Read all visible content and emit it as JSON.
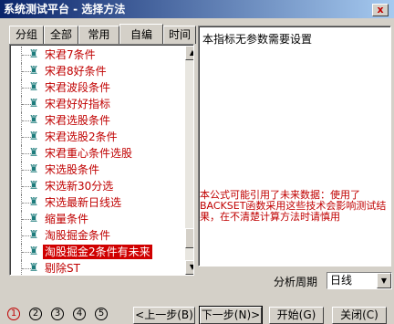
{
  "window": {
    "title": "系统测试平台 - 选择方法",
    "close_label": "x"
  },
  "tabs": [
    {
      "label": "分组"
    },
    {
      "label": "全部"
    },
    {
      "label": "常用"
    },
    {
      "label": "自编"
    },
    {
      "label": "时间"
    }
  ],
  "active_tab": "自编",
  "list": {
    "items": [
      {
        "label": "宋君7条件"
      },
      {
        "label": "宋君8好条件"
      },
      {
        "label": "宋君波段条件"
      },
      {
        "label": "宋君好好指标"
      },
      {
        "label": "宋君选股条件"
      },
      {
        "label": "宋君选股2条件"
      },
      {
        "label": "宋君重心条件选股"
      },
      {
        "label": "宋选股条件"
      },
      {
        "label": "宋选新30分选"
      },
      {
        "label": "宋选最新日线选"
      },
      {
        "label": "缩量条件"
      },
      {
        "label": "淘股掘金条件"
      },
      {
        "label": "淘股掘金2条件有未来",
        "selected": true
      },
      {
        "label": "剔除ST"
      }
    ],
    "icon": "binoculars-icon",
    "scroll_up": "▲",
    "scroll_down": "▼"
  },
  "description": {
    "text": "本指标无参数需要设置",
    "warning": "本公式可能引用了未来数据：使用了BACKSET函数采用这些技术会影响测试结果，在不清楚计算方法时请慎用"
  },
  "period": {
    "label": "分析周期",
    "value": "日线",
    "arrow": "▼"
  },
  "steps": [
    "1",
    "2",
    "3",
    "4",
    "5"
  ],
  "active_step": "1",
  "buttons": {
    "prev": "<上一步(B)",
    "next": "下一步(N)>",
    "start": "开始(G)",
    "close": "关闭(C)"
  },
  "colors": {
    "accent_red": "#c00000",
    "title_blue": "#0a246a",
    "icon_teal": "#1e7c7c"
  }
}
